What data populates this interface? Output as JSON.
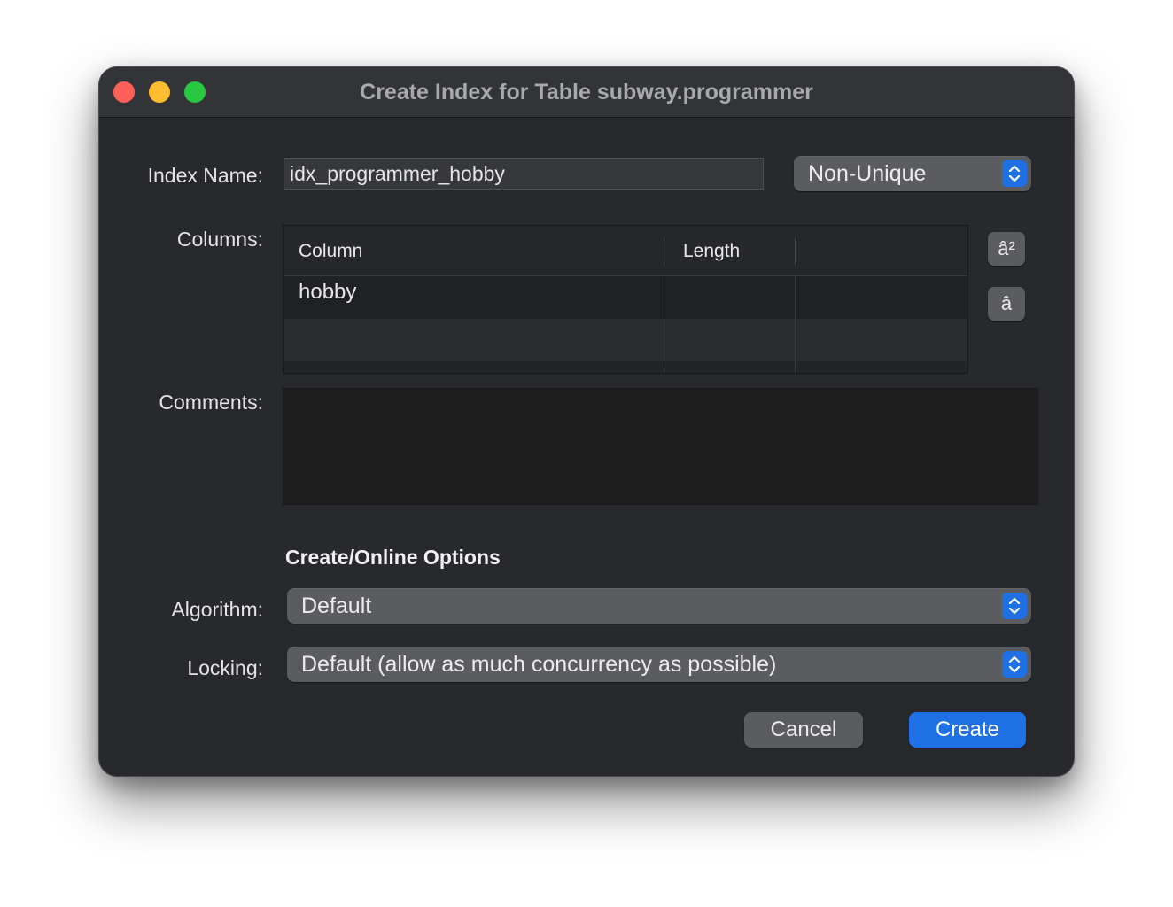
{
  "window": {
    "title": "Create Index for Table subway.programmer"
  },
  "form": {
    "index_name_label": "Index Name:",
    "index_name_value": "idx_programmer_hobby",
    "uniqueness_value": "Non-Unique",
    "columns_label": "Columns:",
    "comments_label": "Comments:",
    "comments_value": ""
  },
  "columns_table": {
    "headers": [
      "Column",
      "Length",
      ""
    ],
    "rows": [
      [
        "hobby",
        "",
        ""
      ]
    ]
  },
  "side_buttons": {
    "move_up_glyph": "â²",
    "move_down_glyph": "â"
  },
  "options": {
    "section_title": "Create/Online Options",
    "algorithm_label": "Algorithm:",
    "algorithm_value": "Default",
    "locking_label": "Locking:",
    "locking_value": "Default (allow as much concurrency as possible)"
  },
  "buttons": {
    "cancel": "Cancel",
    "create": "Create"
  },
  "icons": {
    "close": "close-icon",
    "minimize": "minimize-icon",
    "zoom": "zoom-icon",
    "stepper": "chevron-up-down-icon"
  },
  "colors": {
    "accent": "#1f6fe5",
    "close": "#fe5f57",
    "minimize": "#febc2e",
    "zoom": "#28c840"
  }
}
